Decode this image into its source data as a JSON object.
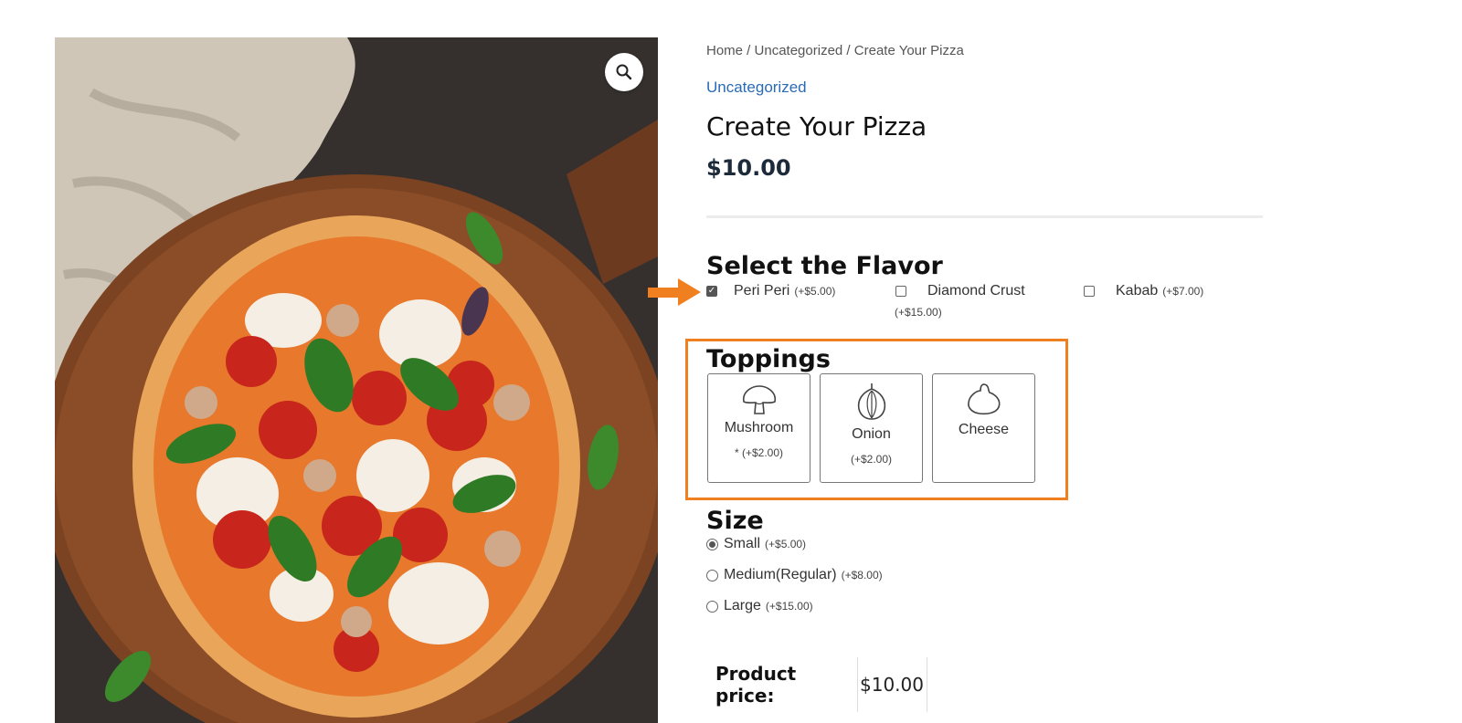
{
  "breadcrumb": {
    "home": "Home",
    "sep1": " / ",
    "category": "Uncategorized",
    "sep2": " / ",
    "current": "Create Your Pizza"
  },
  "product": {
    "category": "Uncategorized",
    "title": "Create Your Pizza",
    "price": "$10.00",
    "image_icon": "pizza-photo",
    "zoom_icon": "magnifier-icon"
  },
  "flavor": {
    "title": "Select the Flavor",
    "options": [
      {
        "label": "Peri Peri",
        "price": "(+$5.00)",
        "checked": true
      },
      {
        "label": "Diamond Crust",
        "price": "(+$15.00)",
        "checked": false
      },
      {
        "label": "Kabab",
        "price": "(+$7.00)",
        "checked": false
      }
    ]
  },
  "toppings": {
    "title": "Toppings",
    "options": [
      {
        "label": "Mushroom",
        "price": "* (+$2.00)",
        "icon": "mushroom-icon"
      },
      {
        "label": "Onion",
        "price": "(+$2.00)",
        "icon": "onion-icon"
      },
      {
        "label": "Cheese",
        "price": "",
        "icon": "cheese-icon"
      }
    ]
  },
  "size": {
    "title": "Size",
    "options": [
      {
        "label": "Small",
        "price": "(+$5.00)",
        "selected": true
      },
      {
        "label": "Medium(Regular)",
        "price": "(+$8.00)",
        "selected": false
      },
      {
        "label": "Large",
        "price": "(+$15.00)",
        "selected": false
      }
    ]
  },
  "summary_table": {
    "label": "Product price:",
    "value": "$10.00"
  },
  "colors": {
    "highlight": "#f07f1f",
    "link": "#2a6bb5",
    "price": "#1c2a3a"
  }
}
